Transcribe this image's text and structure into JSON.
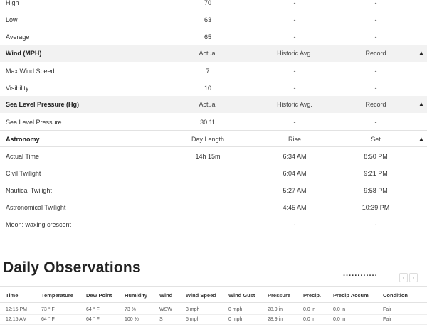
{
  "history": {
    "temp_rows": [
      {
        "label": "High",
        "actual": "70",
        "historic": "-",
        "record": "-"
      },
      {
        "label": "Low",
        "actual": "63",
        "historic": "-",
        "record": "-"
      },
      {
        "label": "Average",
        "actual": "65",
        "historic": "-",
        "record": "-"
      }
    ],
    "wind": {
      "header": {
        "title": "Wind (MPH)",
        "c1": "Actual",
        "c2": "Historic Avg.",
        "c3": "Record",
        "toggle_icon": "caret-up-icon"
      },
      "rows": [
        {
          "label": "Max Wind Speed",
          "actual": "7",
          "historic": "-",
          "record": "-"
        },
        {
          "label": "Visibility",
          "actual": "10",
          "historic": "-",
          "record": "-"
        }
      ]
    },
    "pressure": {
      "header": {
        "title": "Sea Level Pressure (Hg)",
        "c1": "Actual",
        "c2": "Historic Avg.",
        "c3": "Record",
        "toggle_icon": "caret-up-icon"
      },
      "rows": [
        {
          "label": "Sea Level Pressure",
          "actual": "30.11",
          "historic": "-",
          "record": "-"
        }
      ]
    },
    "astronomy": {
      "header": {
        "title": "Astronomy",
        "c1": "Day Length",
        "c2": "Rise",
        "c3": "Set",
        "toggle_icon": "caret-up-icon"
      },
      "rows": [
        {
          "label": "Actual Time",
          "actual": "14h 15m",
          "historic": "6:34 AM",
          "record": "8:50 PM"
        },
        {
          "label": "Civil Twilight",
          "actual": "",
          "historic": "6:04 AM",
          "record": "9:21 PM"
        },
        {
          "label": "Nautical Twilight",
          "actual": "",
          "historic": "5:27 AM",
          "record": "9:58 PM"
        },
        {
          "label": "Astronomical Twilight",
          "actual": "",
          "historic": "4:45 AM",
          "record": "10:39 PM"
        },
        {
          "label": "Moon: waxing crescent",
          "actual": "",
          "historic": "-",
          "record": "-"
        }
      ]
    }
  },
  "daily": {
    "title": "Daily Observations",
    "dots": "............",
    "prev_icon": "‹",
    "next_icon": "›",
    "columns": [
      "Time",
      "Temperature",
      "Dew Point",
      "Humidity",
      "Wind",
      "Wind Speed",
      "Wind Gust",
      "Pressure",
      "Precip.",
      "Precip Accum",
      "Condition"
    ],
    "rows": [
      [
        "12:15 PM",
        "73 ° F",
        "64 ° F",
        "73 %",
        "WSW",
        "3 mph",
        "0 mph",
        "28.9 in",
        "0.0 in",
        "0.0 in",
        "Fair"
      ],
      [
        "12:15 AM",
        "64 ° F",
        "64 ° F",
        "100 %",
        "S",
        "5 mph",
        "0 mph",
        "28.9 in",
        "0.0 in",
        "0.0 in",
        "Fair"
      ]
    ]
  }
}
